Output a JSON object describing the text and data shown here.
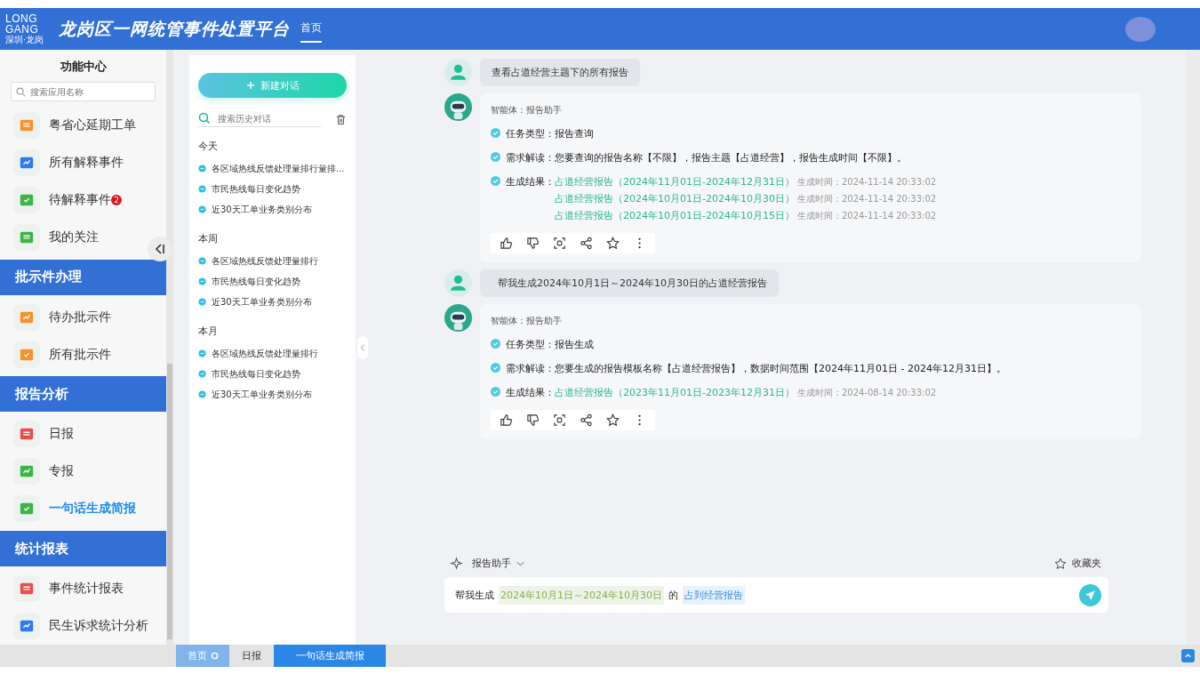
{
  "header": {
    "logo_top": "LONG",
    "logo_mid": "GANG",
    "logo_sub": "深圳·龙岗",
    "title": "龙岗区一网统管事件处置平台",
    "nav": [
      {
        "label": "首页",
        "selected": true
      }
    ]
  },
  "sidebar": {
    "title": "功能中心",
    "search": {
      "placeholder": "搜索应用名称"
    },
    "items": [
      {
        "kind": "item",
        "label": "粤省心延期工单",
        "color": "#f5922f",
        "selected": false
      },
      {
        "kind": "item",
        "label": "所有解释事件",
        "color": "#2f7bea",
        "selected": false
      },
      {
        "kind": "item",
        "label": "待解释事件",
        "color": "#3bb54a",
        "selected": false,
        "badge": "2"
      },
      {
        "kind": "item",
        "label": "我的关注",
        "color": "#3bb54a",
        "selected": false
      },
      {
        "kind": "section",
        "label": "批示件办理"
      },
      {
        "kind": "item",
        "label": "待办批示件",
        "color": "#f5922f",
        "selected": false
      },
      {
        "kind": "item",
        "label": "所有批示件",
        "color": "#f5922f",
        "selected": false
      },
      {
        "kind": "section",
        "label": "报告分析"
      },
      {
        "kind": "item",
        "label": "日报",
        "color": "#ea4d4d",
        "selected": false
      },
      {
        "kind": "item",
        "label": "专报",
        "color": "#3bb54a",
        "selected": false
      },
      {
        "kind": "item",
        "label": "一句话生成简报",
        "color": "#3bb54a",
        "selected": true
      },
      {
        "kind": "section",
        "label": "统计报表"
      },
      {
        "kind": "item",
        "label": "事件统计报表",
        "color": "#ea4d4d",
        "selected": false
      },
      {
        "kind": "item",
        "label": "民生诉求统计分析",
        "color": "#2f7bea",
        "selected": false
      }
    ]
  },
  "history": {
    "new_button": "新建对话",
    "search": {
      "placeholder": "搜索历史对话"
    },
    "groups": [
      {
        "label": "今天",
        "items": [
          "各区域热线反馈处理量排行量排...",
          "市民热线每日变化趋势",
          "近30天工单业务类别分布"
        ]
      },
      {
        "label": "本周",
        "items": [
          "各区域热线反馈处理量排行",
          "市民热线每日变化趋势",
          "近30天工单业务类别分布"
        ]
      },
      {
        "label": "本月",
        "items": [
          "各区域热线反馈处理量排行",
          "市民热线每日变化趋势",
          "近30天工单业务类别分布"
        ]
      }
    ]
  },
  "messages": [
    {
      "kind": "user",
      "text": "查看占道经营主题下的所有报告"
    },
    {
      "kind": "bot",
      "agent": "智能体：报告助手",
      "rows": [
        {
          "kind": "text",
          "label": "任务类型：",
          "text": "报告查询"
        },
        {
          "kind": "text",
          "label": "需求解读：",
          "text": "您要查询的报告名称【不限】，报告主题【占道经营】，报告生成时间【不限】。"
        },
        {
          "kind": "results",
          "label": "生成结果：",
          "results": [
            {
              "link": "占道经营报告（2024年11月01日-2024年12月31日）",
              "time_label": "生成时间：",
              "time": "2024-11-14 20:33:02"
            },
            {
              "link": "占道经营报告（2024年10月01日-2024年10月30日）",
              "time_label": "生成时间：",
              "time": "2024-11-14 20:33:02"
            },
            {
              "link": "占道经营报告（2024年10月01日-2024年10月15日）",
              "time_label": "生成时间：",
              "time": "2024-11-14 20:33:02"
            }
          ]
        }
      ]
    },
    {
      "kind": "user",
      "text": "帮我生成2024年10月1日～2024年10月30日的占道经营报告"
    },
    {
      "kind": "bot",
      "agent": "智能体：报告助手",
      "rows": [
        {
          "kind": "text",
          "label": "任务类型：",
          "text": "报告生成"
        },
        {
          "kind": "text",
          "label": "需求解读：",
          "text": "您要生成的报告模板名称【占道经营报告】，数据时间范围【2024年11月01日 - 2024年12月31日】。"
        },
        {
          "kind": "results",
          "label": "生成结果：",
          "results": [
            {
              "link": "占道经营报告（2023年11月01日-2023年12月31日）",
              "time_label": "生成时间：",
              "time": "2024-08-14 20:33:02"
            }
          ]
        }
      ]
    }
  ],
  "composer": {
    "agent": "报告助手",
    "favorites": "收藏夹",
    "parts": [
      {
        "kind": "plain",
        "text": "帮我生成"
      },
      {
        "kind": "time",
        "text": "2024年10月1日～2024年10月30日"
      },
      {
        "kind": "plain",
        "text": "的"
      },
      {
        "kind": "topic",
        "text": "占到经营报告"
      }
    ]
  },
  "tabs": [
    {
      "kind": "home",
      "label": "首页",
      "selected": false
    },
    {
      "kind": "page",
      "label": "日报",
      "selected": false
    },
    {
      "kind": "page",
      "label": "一句话生成简报",
      "selected": true
    }
  ]
}
